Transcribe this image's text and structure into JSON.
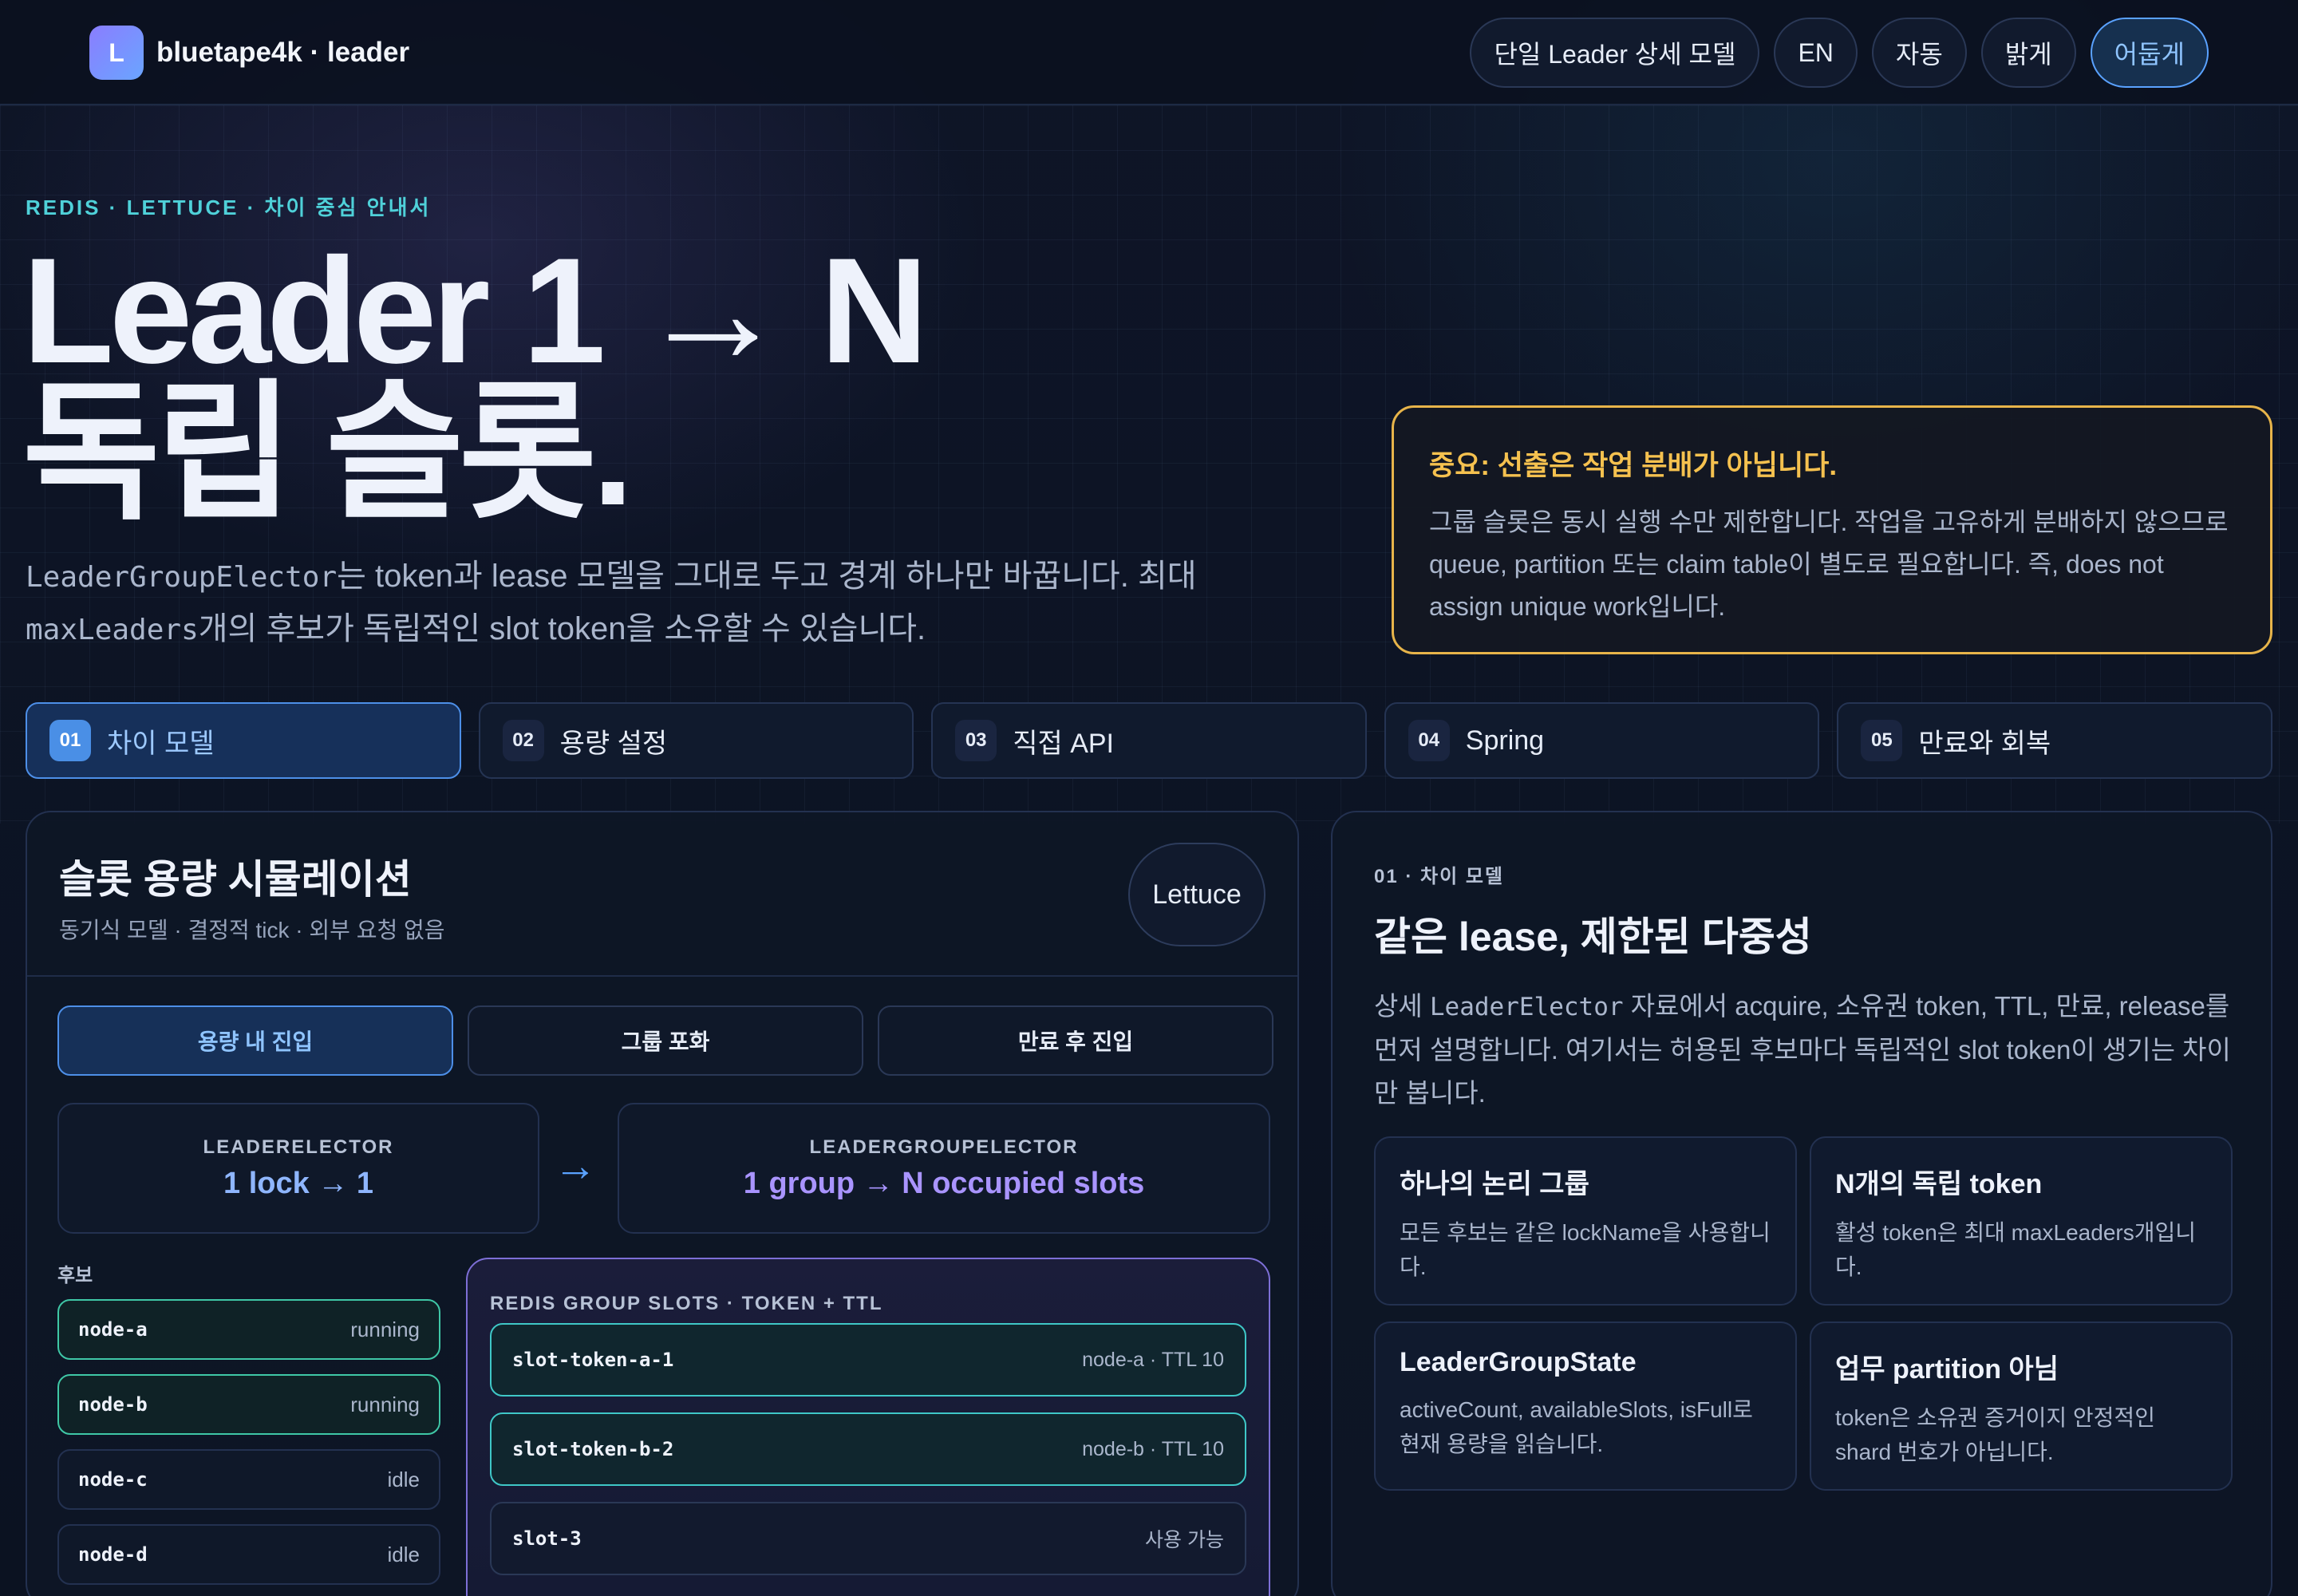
{
  "header": {
    "logo_letter": "L",
    "brand": "bluetape4k · leader",
    "nav": [
      {
        "label": "단일 Leader 상세 모델",
        "active": false
      },
      {
        "label": "EN",
        "active": false
      },
      {
        "label": "자동",
        "active": false
      },
      {
        "label": "밝게",
        "active": false
      },
      {
        "label": "어둡게",
        "active": true
      }
    ]
  },
  "hero": {
    "eyebrow": "REDIS · LETTUCE · 차이 중심 안내서",
    "title_line1": "Leader 1 → N",
    "title_line2": "독립 슬롯.",
    "sub_code1": "LeaderGroupElector",
    "sub_text1": "는 token과 lease 모델을 그대로 두고 경계 하나만 바꿉니다. 최대",
    "sub_code2": "maxLeaders",
    "sub_text2": "개의 후보가 독립적인 slot token을 소유할 수 있습니다."
  },
  "alert": {
    "title": "중요: 선출은 작업 분배가 아닙니다.",
    "body": "그룹 슬롯은 동시 실행 수만 제한합니다. 작업을 고유하게 분배하지 않으므로 queue, partition 또는 claim table이 별도로 필요합니다. 즉, does not assign unique work입니다."
  },
  "tabs": [
    {
      "num": "01",
      "label": "차이 모델",
      "active": true
    },
    {
      "num": "02",
      "label": "용량 설정",
      "active": false
    },
    {
      "num": "03",
      "label": "직접 API",
      "active": false
    },
    {
      "num": "04",
      "label": "Spring",
      "active": false
    },
    {
      "num": "05",
      "label": "만료와 회복",
      "active": false
    }
  ],
  "simulation": {
    "title": "슬롯 용량 시뮬레이션",
    "subtitle": "동기식 모델 · 결정적 tick · 외부 요청 없음",
    "badge": "Lettuce",
    "scenarios": [
      {
        "label": "용량 내 진입",
        "active": true
      },
      {
        "label": "그룹 포화",
        "active": false
      },
      {
        "label": "만료 후 진입",
        "active": false
      }
    ],
    "compare_left_key": "LEADERELECTOR",
    "compare_left_val": "1 lock → 1",
    "compare_arrow": "→",
    "compare_right_key": "LEADERGROUPELECTOR",
    "compare_right_val": "1 group → N occupied slots",
    "candidates_label": "후보",
    "candidates": [
      {
        "name": "node-a",
        "status": "running"
      },
      {
        "name": "node-b",
        "status": "running"
      },
      {
        "name": "node-c",
        "status": "idle"
      },
      {
        "name": "node-d",
        "status": "idle"
      }
    ],
    "slots_title": "REDIS GROUP SLOTS · TOKEN + TTL",
    "slots": [
      {
        "name": "slot-token-a-1",
        "meta": "node-a · TTL 10"
      },
      {
        "name": "slot-token-b-2",
        "meta": "node-b · TTL 10"
      },
      {
        "name": "slot-3",
        "meta": "사용 가능"
      }
    ]
  },
  "detail": {
    "eyebrow": "01 · 차이 모델",
    "title": "같은 lease, 제한된 다중성",
    "body_pre": "상세 ",
    "body_code": "LeaderElector",
    "body_post": " 자료에서 acquire, 소유권 token, TTL, 만료, release를 먼저 설명합니다. 여기서는 허용된 후보마다 독립적인 slot token이 생기는 차이만 봅니다.",
    "cards": [
      {
        "title": "하나의 논리 그룹",
        "body": "모든 후보는 같은 lockName을 사용합니다."
      },
      {
        "title": "N개의 독립 token",
        "body": "활성 token은 최대 maxLeaders개입니다."
      },
      {
        "title": "LeaderGroupState",
        "body": "activeCount, availableSlots, isFull로 현재 용량을 읽습니다."
      },
      {
        "title": "업무 partition 아님",
        "body": "token은 소유권 증거이지 안정적인 shard 번호가 아닙니다."
      }
    ]
  },
  "colors": {
    "accent_blue": "#5aa2ff",
    "accent_teal": "#4fd1d9",
    "accent_purple": "#9f8cff",
    "warning": "#e7b44a"
  }
}
